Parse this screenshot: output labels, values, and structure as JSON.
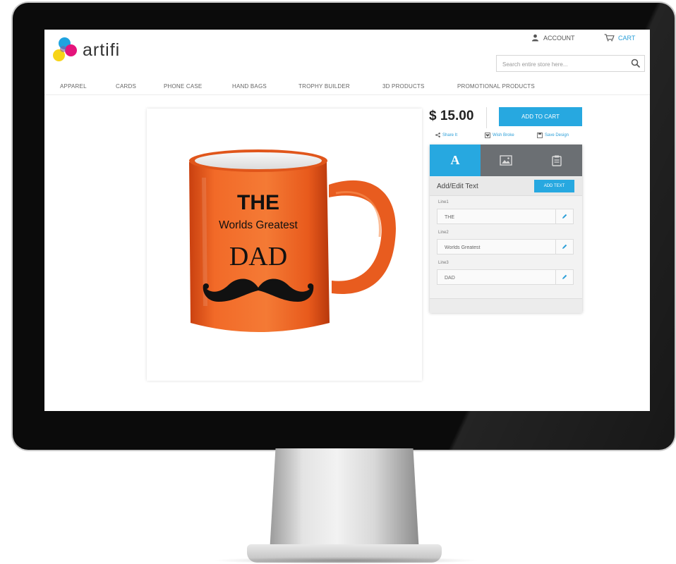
{
  "header": {
    "logo_text": "artifi",
    "account_label": "ACCOUNT",
    "cart_label": "CART",
    "search_placeholder": "Search entire store here..."
  },
  "nav": {
    "items": [
      {
        "label": "APPAREL"
      },
      {
        "label": "CARDS"
      },
      {
        "label": "PHONE CASE"
      },
      {
        "label": "HAND BAGS"
      },
      {
        "label": "TROPHY BUILDER"
      },
      {
        "label": "3D PRODUCTS"
      },
      {
        "label": "PROMOTIONAL PRODUCTS"
      }
    ]
  },
  "product": {
    "mug_color": "#f15a1f",
    "mug_lines": [
      "THE",
      "Worlds Greatest",
      "DAD"
    ],
    "decoration": "mustache"
  },
  "purchase": {
    "price": "$ 15.00",
    "add_to_cart_label": "ADD TO CART",
    "actions": [
      {
        "label": "Share It",
        "icon": "share-icon"
      },
      {
        "label": "Wish Broke",
        "icon": "heart-box-icon"
      },
      {
        "label": "Save Design",
        "icon": "save-icon"
      }
    ]
  },
  "designer": {
    "tabs": [
      {
        "label": "A",
        "icon": "text-tab-icon",
        "active": true
      },
      {
        "label": "",
        "icon": "image-icon",
        "active": false
      },
      {
        "label": "",
        "icon": "clipart-icon",
        "active": false
      }
    ],
    "title": "Add/Edit Text",
    "add_text_label": "ADD TEXT",
    "lines": [
      {
        "label": "Line1",
        "value": "THE"
      },
      {
        "label": "Line2",
        "value": "Worlds Greatest"
      },
      {
        "label": "Line3",
        "value": "DAD"
      }
    ]
  },
  "colors": {
    "accent": "#27a8e0",
    "tab_bar": "#6b6f73",
    "monitor_bezel": "#0b0b0b"
  }
}
